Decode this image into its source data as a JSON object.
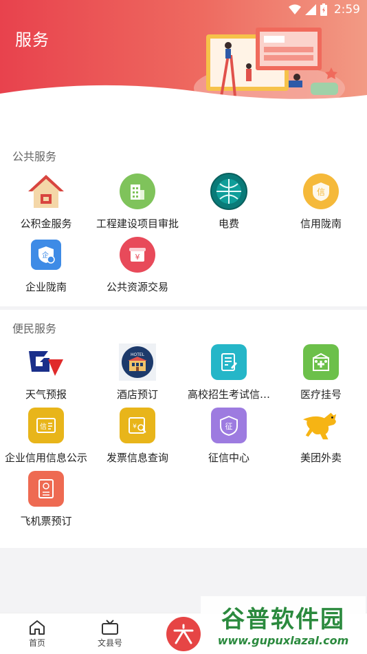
{
  "status": {
    "time": "2:59"
  },
  "header": {
    "title": "服务"
  },
  "public_services": {
    "title": "公共服务",
    "items": [
      {
        "label": "公积金服务",
        "icon": "house-icon"
      },
      {
        "label": "工程建设项目审批",
        "icon": "building-icon"
      },
      {
        "label": "电费",
        "icon": "state-grid-logo-icon"
      },
      {
        "label": "信用陇南",
        "icon": "credit-badge-icon"
      },
      {
        "label": "企业陇南",
        "icon": "enterprise-shield-icon"
      },
      {
        "label": "公共资源交易",
        "icon": "yuan-box-icon"
      }
    ]
  },
  "convenience_services": {
    "title": "便民服务",
    "items": [
      {
        "label": "天气预报",
        "icon": "weather-logo-icon"
      },
      {
        "label": "酒店预订",
        "icon": "hotel-icon"
      },
      {
        "label": "高校招生考试信…",
        "icon": "exam-document-icon"
      },
      {
        "label": "医疗挂号",
        "icon": "medical-icon"
      },
      {
        "label": "企业信用信息公示",
        "icon": "credit-info-icon"
      },
      {
        "label": "发票信息查询",
        "icon": "invoice-icon"
      },
      {
        "label": "征信中心",
        "icon": "credit-center-icon"
      },
      {
        "label": "美团外卖",
        "icon": "meituan-kangaroo-icon"
      },
      {
        "label": "飞机票预订",
        "icon": "flight-ticket-icon"
      }
    ]
  },
  "bottom_nav": {
    "home": "首页",
    "county": "文县号"
  },
  "watermark": {
    "title": "谷普软件园",
    "url": "www.gupuxlazal.com"
  },
  "colors": {
    "brand": "#e8424d"
  }
}
